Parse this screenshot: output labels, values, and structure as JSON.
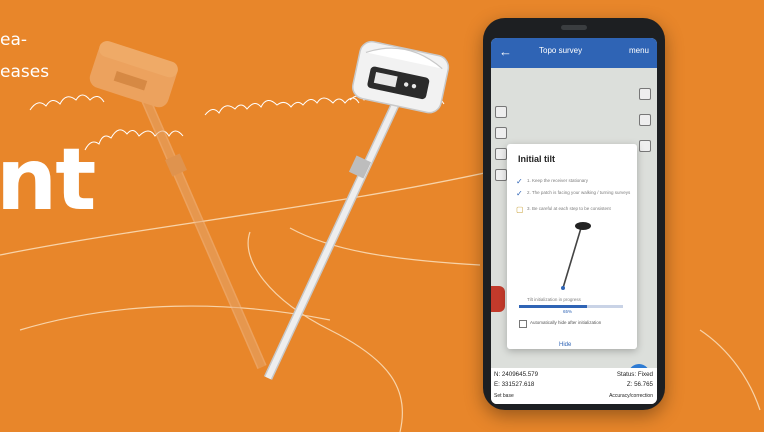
{
  "hero": {
    "line1": "ea-",
    "line2": "eases",
    "big": "nt"
  },
  "app": {
    "back_icon": "arrow-left-icon",
    "title": "Topo survey",
    "menu": "menu"
  },
  "dialog": {
    "title": "Initial tilt",
    "steps": [
      "1. Keep the receiver stationary",
      "2. The patch is facing your walking / turning surveys",
      "3. Be careful at each step to be consistent"
    ],
    "progress_label": "Tilt initialization in progress",
    "progress_percent": "65%",
    "progress_value": 0.65,
    "auto_hide": "Automatically hide after initialization",
    "hide_button": "Hide"
  },
  "status": {
    "n_label": "N",
    "n_value": "2409645.579",
    "e_label": "E",
    "e_value": "331527.618",
    "status_label": "Status",
    "status_value": "Fixed",
    "z_label": "Z",
    "z_value": "56.765",
    "set_base": "Set base",
    "accuracy": "Accuracy/correction"
  },
  "colors": {
    "background": "#E8862A",
    "app_blue": "#2f64b5"
  }
}
